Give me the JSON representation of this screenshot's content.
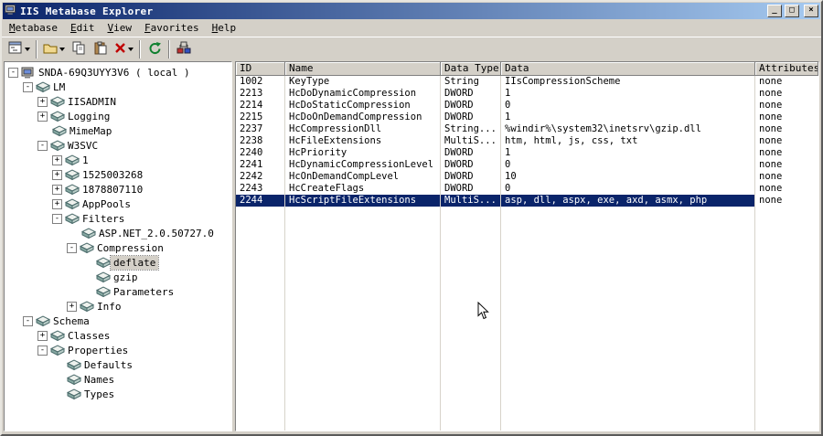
{
  "colors": {
    "chrome": "#d4d0c8",
    "titlebar_left": "#0a246a",
    "titlebar_right": "#a6caf0",
    "selection": "#0a246a",
    "selection_text": "#ffffff"
  },
  "window": {
    "title": "IIS Metabase Explorer",
    "minimize_glyph": "_",
    "maximize_glyph": "□",
    "close_glyph": "×"
  },
  "menu": {
    "items": [
      "Metabase",
      "Edit",
      "View",
      "Favorites",
      "Help"
    ]
  },
  "toolbar": {
    "icons": [
      "tree-view-dropdown-icon",
      "new-key-icon",
      "copy-icon",
      "paste-icon",
      "delete-icon",
      "refresh-icon",
      "connect-machine-icon"
    ]
  },
  "tree": {
    "items": [
      {
        "label": "SNDA-69Q3UYY3V6 ( local )",
        "depth": 0,
        "expand": "minus",
        "icon": "computer",
        "selected": false
      },
      {
        "label": "LM",
        "depth": 1,
        "expand": "minus",
        "icon": "key",
        "selected": false
      },
      {
        "label": "IISADMIN",
        "depth": 2,
        "expand": "plus",
        "icon": "key",
        "selected": false
      },
      {
        "label": "Logging",
        "depth": 2,
        "expand": "plus",
        "icon": "key",
        "selected": false
      },
      {
        "label": "MimeMap",
        "depth": 2,
        "expand": "none",
        "icon": "key",
        "selected": false
      },
      {
        "label": "W3SVC",
        "depth": 2,
        "expand": "minus",
        "icon": "key",
        "selected": false
      },
      {
        "label": "1",
        "depth": 3,
        "expand": "plus",
        "icon": "key",
        "selected": false
      },
      {
        "label": "1525003268",
        "depth": 3,
        "expand": "plus",
        "icon": "key",
        "selected": false
      },
      {
        "label": "1878807110",
        "depth": 3,
        "expand": "plus",
        "icon": "key",
        "selected": false
      },
      {
        "label": "AppPools",
        "depth": 3,
        "expand": "plus",
        "icon": "key",
        "selected": false
      },
      {
        "label": "Filters",
        "depth": 3,
        "expand": "minus",
        "icon": "key",
        "selected": false
      },
      {
        "label": "ASP.NET_2.0.50727.0",
        "depth": 4,
        "expand": "none",
        "icon": "key",
        "selected": false
      },
      {
        "label": "Compression",
        "depth": 4,
        "expand": "minus",
        "icon": "key",
        "selected": false
      },
      {
        "label": "deflate",
        "depth": 5,
        "expand": "none",
        "icon": "key",
        "selected": true
      },
      {
        "label": "gzip",
        "depth": 5,
        "expand": "none",
        "icon": "key",
        "selected": false
      },
      {
        "label": "Parameters",
        "depth": 5,
        "expand": "none",
        "icon": "key",
        "selected": false
      },
      {
        "label": "Info",
        "depth": 4,
        "expand": "plus",
        "icon": "key",
        "selected": false
      },
      {
        "label": "Schema",
        "depth": 1,
        "expand": "minus",
        "icon": "key",
        "selected": false
      },
      {
        "label": "Classes",
        "depth": 2,
        "expand": "plus",
        "icon": "key",
        "selected": false
      },
      {
        "label": "Properties",
        "depth": 2,
        "expand": "minus",
        "icon": "key",
        "selected": false
      },
      {
        "label": "Defaults",
        "depth": 3,
        "expand": "none",
        "icon": "key",
        "selected": false
      },
      {
        "label": "Names",
        "depth": 3,
        "expand": "none",
        "icon": "key",
        "selected": false
      },
      {
        "label": "Types",
        "depth": 3,
        "expand": "none",
        "icon": "key",
        "selected": false
      }
    ]
  },
  "table": {
    "columns": [
      "ID",
      "Name",
      "Data Type",
      "Data",
      "Attributes"
    ],
    "selected_row": 10,
    "rows": [
      [
        "1002",
        "KeyType",
        "String",
        "IIsCompressionScheme",
        "none"
      ],
      [
        "2213",
        "HcDoDynamicCompression",
        "DWORD",
        "1",
        "none"
      ],
      [
        "2214",
        "HcDoStaticCompression",
        "DWORD",
        "0",
        "none"
      ],
      [
        "2215",
        "HcDoOnDemandCompression",
        "DWORD",
        "1",
        "none"
      ],
      [
        "2237",
        "HcCompressionDll",
        "String...",
        "%windir%\\system32\\inetsrv\\gzip.dll",
        "none"
      ],
      [
        "2238",
        "HcFileExtensions",
        "MultiS...",
        "htm, html, js, css, txt",
        "none"
      ],
      [
        "2240",
        "HcPriority",
        "DWORD",
        "1",
        "none"
      ],
      [
        "2241",
        "HcDynamicCompressionLevel",
        "DWORD",
        "0",
        "none"
      ],
      [
        "2242",
        "HcOnDemandCompLevel",
        "DWORD",
        "10",
        "none"
      ],
      [
        "2243",
        "HcCreateFlags",
        "DWORD",
        "0",
        "none"
      ],
      [
        "2244",
        "HcScriptFileExtensions",
        "MultiS...",
        "asp, dll, aspx, exe, axd, asmx, php",
        "none"
      ]
    ]
  }
}
